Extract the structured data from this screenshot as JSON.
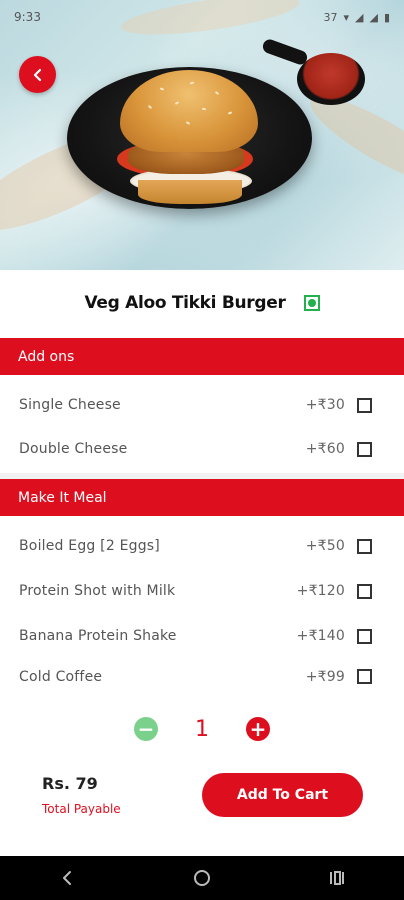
{
  "status_bar": {
    "time": "9:33",
    "signal_text": "37"
  },
  "product": {
    "name": "Veg Aloo Tikki Burger",
    "veg_indicator": "veg-icon"
  },
  "sections": [
    {
      "title": "Add ons",
      "options": [
        {
          "name": "Single Cheese",
          "price": "+₹30"
        },
        {
          "name": "Double Cheese",
          "price": "+₹60"
        }
      ]
    },
    {
      "title": "Make It Meal",
      "options": [
        {
          "name": "Boiled Egg [2 Eggs]",
          "price": "+₹50"
        },
        {
          "name": "Protein Shot with Milk",
          "price": "+₹120"
        },
        {
          "name": "Banana Protein Shake",
          "price": "+₹140"
        },
        {
          "name": "Cold Coffee",
          "price": "+₹99"
        }
      ]
    }
  ],
  "quantity": {
    "value": "1",
    "minus": "−",
    "plus": "+"
  },
  "footer": {
    "total_price": "Rs. 79",
    "total_label": "Total Payable",
    "cart_button": "Add To Cart"
  },
  "colors": {
    "accent": "#dd0f1f",
    "veg_green": "#22b14c",
    "minus_green": "#7bd08b"
  }
}
